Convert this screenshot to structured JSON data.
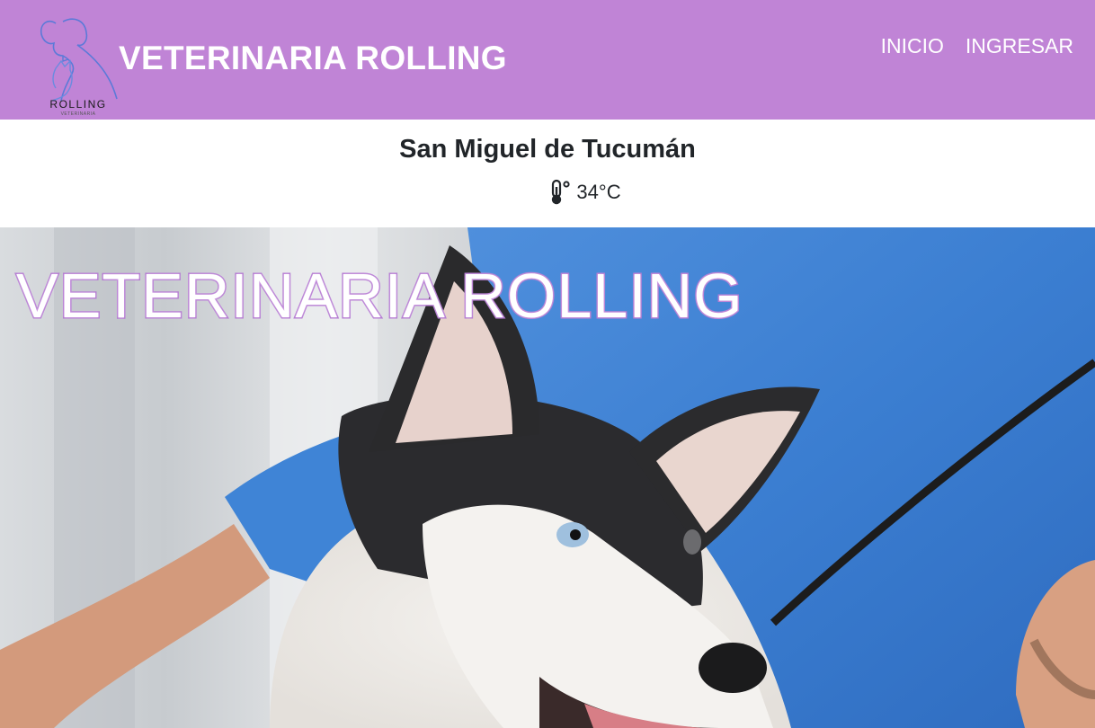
{
  "navbar": {
    "logo_text": "ROLLING",
    "logo_subtext": "VETERINARIA",
    "brand": "VETERINARIA ROLLING",
    "links": [
      {
        "label": "INICIO"
      },
      {
        "label": "INGRESAR"
      }
    ],
    "background_color": "#c084d6"
  },
  "weather": {
    "city": "San Miguel de Tucumán",
    "icon": "thermometer-icon",
    "temperature": "34°C"
  },
  "hero": {
    "title": "VETERINARIA ROLLING",
    "image": "husky-dog-with-veterinarian-photo"
  }
}
